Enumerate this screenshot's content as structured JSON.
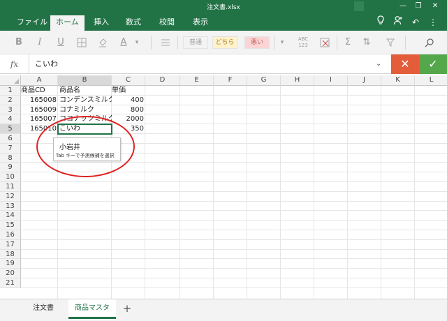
{
  "window": {
    "title": "注文書.xlsx"
  },
  "ribbon": {
    "tabs": [
      "ファイル",
      "ホーム",
      "挿入",
      "数式",
      "校閲",
      "表示"
    ],
    "active_tab": "ホーム"
  },
  "toolbar": {
    "bold": "B",
    "italic": "I",
    "underline": "U",
    "font_color": "A",
    "dropdown": "▾",
    "style_good": "普通",
    "style_neutral": "どちら",
    "style_bad": "悪い",
    "number_format": "ABC\n123",
    "sum": "Σ"
  },
  "formula": {
    "fx": "fx",
    "value": "こいわ"
  },
  "grid": {
    "columns": [
      "A",
      "B",
      "C",
      "D",
      "E",
      "F",
      "G",
      "H",
      "I",
      "J",
      "K",
      "L"
    ],
    "selected_column": "B",
    "rows": [
      "1",
      "2",
      "3",
      "4",
      "5",
      "6",
      "7",
      "8",
      "9",
      "10",
      "11",
      "12",
      "13",
      "14",
      "15",
      "16",
      "17",
      "18",
      "19",
      "20",
      "21"
    ],
    "selected_row": "5",
    "cells": {
      "A1": "商品CD",
      "B1": "商品名",
      "C1": "単価",
      "A2": "165008",
      "B2": "コンデンスミルク",
      "C2": "400",
      "A3": "165009",
      "B3": "コナミルク",
      "C3": "800",
      "A4": "165007",
      "B4": "ココナッツミルク",
      "C4": "2000",
      "A5": "165010",
      "B5": "こいわ",
      "C5": "350"
    }
  },
  "autocomplete": {
    "suggestion": "小岩井",
    "hint": "Tab キーで予測候補を選択"
  },
  "sheets": {
    "tabs": [
      "注文書",
      "商品マスタ"
    ],
    "active": "商品マスタ",
    "add": "+"
  },
  "colors": {
    "brand": "#217346",
    "cancel": "#e45d3b",
    "confirm": "#54a74b",
    "annotation": "#e02020"
  }
}
